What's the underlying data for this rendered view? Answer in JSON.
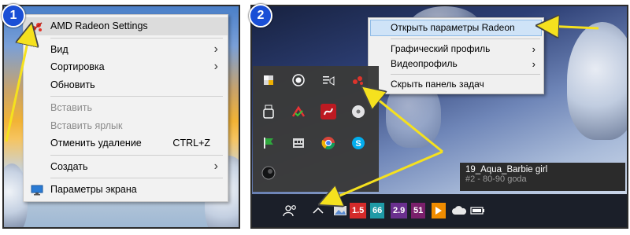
{
  "left_panel": {
    "badge": "1",
    "menu": {
      "items": [
        {
          "label": "AMD Radeon Settings",
          "icon": "amd-radeon-icon",
          "highlighted": true
        },
        {
          "label": "Вид",
          "submenu": true
        },
        {
          "label": "Сортировка",
          "submenu": true
        },
        {
          "label": "Обновить"
        },
        {
          "label": "Вставить",
          "disabled": true
        },
        {
          "label": "Вставить ярлык",
          "disabled": true
        },
        {
          "label": "Отменить удаление",
          "shortcut": "CTRL+Z"
        },
        {
          "label": "Создать",
          "submenu": true
        },
        {
          "label": "Параметры экрана",
          "icon": "display-icon"
        }
      ]
    }
  },
  "right_panel": {
    "badge": "2",
    "tray_menu": {
      "items": [
        {
          "label": "Открыть параметры Radeon",
          "highlighted": true
        },
        {
          "label": "Графический профиль",
          "submenu": true
        },
        {
          "label": "Видеопрофиль",
          "submenu": true
        },
        {
          "label": "Скрыть панель задач"
        }
      ]
    },
    "tooltip": {
      "title": "19_Aqua_Barbie girl",
      "subtitle": "#2 - 80-90 goda"
    },
    "taskbar": {
      "badges": {
        "red": "1.5",
        "teal": "66",
        "purple_a": "2.9",
        "purple_b": "51"
      }
    }
  },
  "colors": {
    "arrow": "#f5e11e",
    "badge": "#1a4fd6",
    "amd_red": "#e3342a"
  }
}
